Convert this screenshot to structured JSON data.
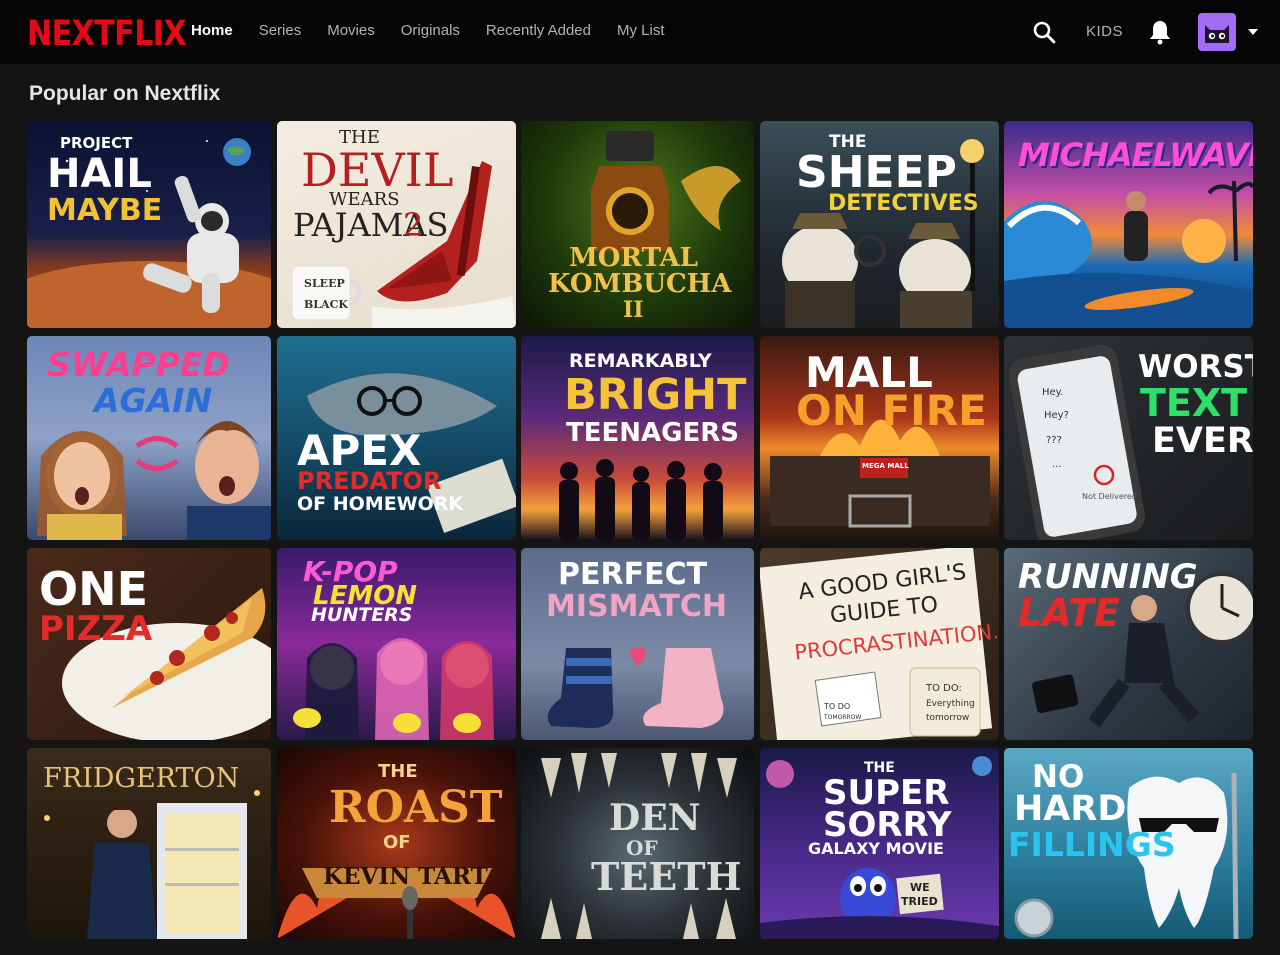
{
  "app": {
    "logo": "NEXTFLIX"
  },
  "nav": {
    "items": [
      {
        "label": "Home",
        "active": true
      },
      {
        "label": "Series",
        "active": false
      },
      {
        "label": "Movies",
        "active": false
      },
      {
        "label": "Originals",
        "active": false
      },
      {
        "label": "Recently Added",
        "active": false
      },
      {
        "label": "My List",
        "active": false
      }
    ],
    "kids_label": "KIDS",
    "icons": [
      "search-icon",
      "bell-icon",
      "avatar",
      "chevron-down-icon"
    ]
  },
  "row": {
    "title": "Popular on Nextflix",
    "tiles": [
      {
        "lines": [
          "PROJECT",
          "HAIL",
          "MAYBE"
        ]
      },
      {
        "lines": [
          "THE",
          "DEVIL",
          "WEARS",
          "PAJAMAS",
          "2"
        ],
        "mug": [
          "SLEEP",
          "BLACK"
        ]
      },
      {
        "lines": [
          "MORTAL",
          "KOMBUCHA",
          "II"
        ]
      },
      {
        "lines": [
          "THE",
          "SHEEP",
          "DETECTIVES"
        ]
      },
      {
        "lines": [
          "MICHAELWAVE"
        ]
      },
      {
        "lines": [
          "SWAPPED",
          "AGAIN"
        ]
      },
      {
        "lines": [
          "APEX",
          "PREDATOR",
          "OF HOMEWORK"
        ]
      },
      {
        "lines": [
          "REMARKABLY",
          "BRIGHT",
          "TEENAGERS"
        ]
      },
      {
        "lines": [
          "MALL",
          "ON FIRE"
        ],
        "sign": "MEGA MALL"
      },
      {
        "lines": [
          "WORST",
          "TEXT",
          "EVER"
        ],
        "bubbles": [
          "Hey.",
          "Hey?",
          "???",
          "..."
        ],
        "status": "Not Delivered"
      },
      {
        "lines": [
          "ONE",
          "PIZZA"
        ]
      },
      {
        "lines": [
          "K-POP",
          "LEMON",
          "HUNTERS"
        ]
      },
      {
        "lines": [
          "PERFECT",
          "MISMATCH"
        ]
      },
      {
        "lines": [
          "A GOOD GIRL'S",
          "GUIDE TO",
          "PROCRASTINATION."
        ],
        "mug": [
          "TO DO:",
          "Everything",
          "tomorrow"
        ],
        "note": "TO DO",
        "note2": "TOMORROW"
      },
      {
        "lines": [
          "RUNNING",
          "LATE"
        ]
      },
      {
        "lines": [
          "FRIDGERTON"
        ]
      },
      {
        "lines": [
          "THE",
          "ROAST",
          "OF",
          "KEVIN TART"
        ]
      },
      {
        "lines": [
          "DEN",
          "OF",
          "TEETH"
        ]
      },
      {
        "lines": [
          "THE",
          "SUPER",
          "SORRY",
          "GALAXY MOVIE"
        ],
        "sign": [
          "WE",
          "TRIED"
        ]
      },
      {
        "lines": [
          "NO",
          "HARD",
          "FILLINGS"
        ]
      }
    ]
  },
  "colors": {
    "brand": "#e50914",
    "background": "#141414",
    "nav_bg": "#050505",
    "avatar": "#a36cf7"
  }
}
